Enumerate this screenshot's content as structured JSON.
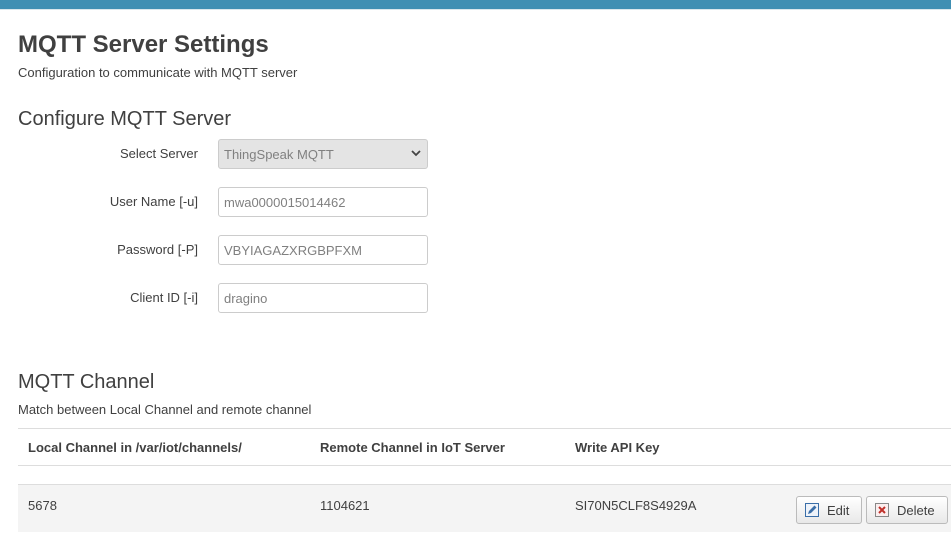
{
  "header": {
    "title": "MQTT Server Settings",
    "description": "Configuration to communicate with MQTT server"
  },
  "configure": {
    "section_title": "Configure MQTT Server",
    "fields": [
      {
        "label": "Select Server",
        "value": "ThingSpeak MQTT",
        "type": "select"
      },
      {
        "label": "User Name [-u]",
        "value": "mwa0000015014462",
        "type": "text"
      },
      {
        "label": "Password [-P]",
        "value": "VBYIAGAZXRGBPFXM",
        "type": "text"
      },
      {
        "label": "Client ID [-i]",
        "value": "dragino",
        "type": "text"
      }
    ]
  },
  "channel": {
    "section_title": "MQTT Channel",
    "description": "Match between Local Channel and remote channel",
    "columns": [
      "Local Channel in /var/iot/channels/",
      "Remote Channel in IoT Server",
      "Write API Key"
    ],
    "rows": [
      {
        "local": "5678",
        "remote": "1104621",
        "key": "SI70N5CLF8S4929A",
        "edit_label": "Edit",
        "delete_label": "Delete"
      }
    ]
  },
  "colors": {
    "topbar": "#3f8fb3",
    "text": "#404040",
    "field_text": "#808080",
    "delete_icon": "#c0302a",
    "edit_icon": "#3a6ea8"
  },
  "icons": {
    "select_chevron": "chevron-down-icon",
    "edit": "pencil-icon",
    "delete": "delete-x-icon"
  }
}
